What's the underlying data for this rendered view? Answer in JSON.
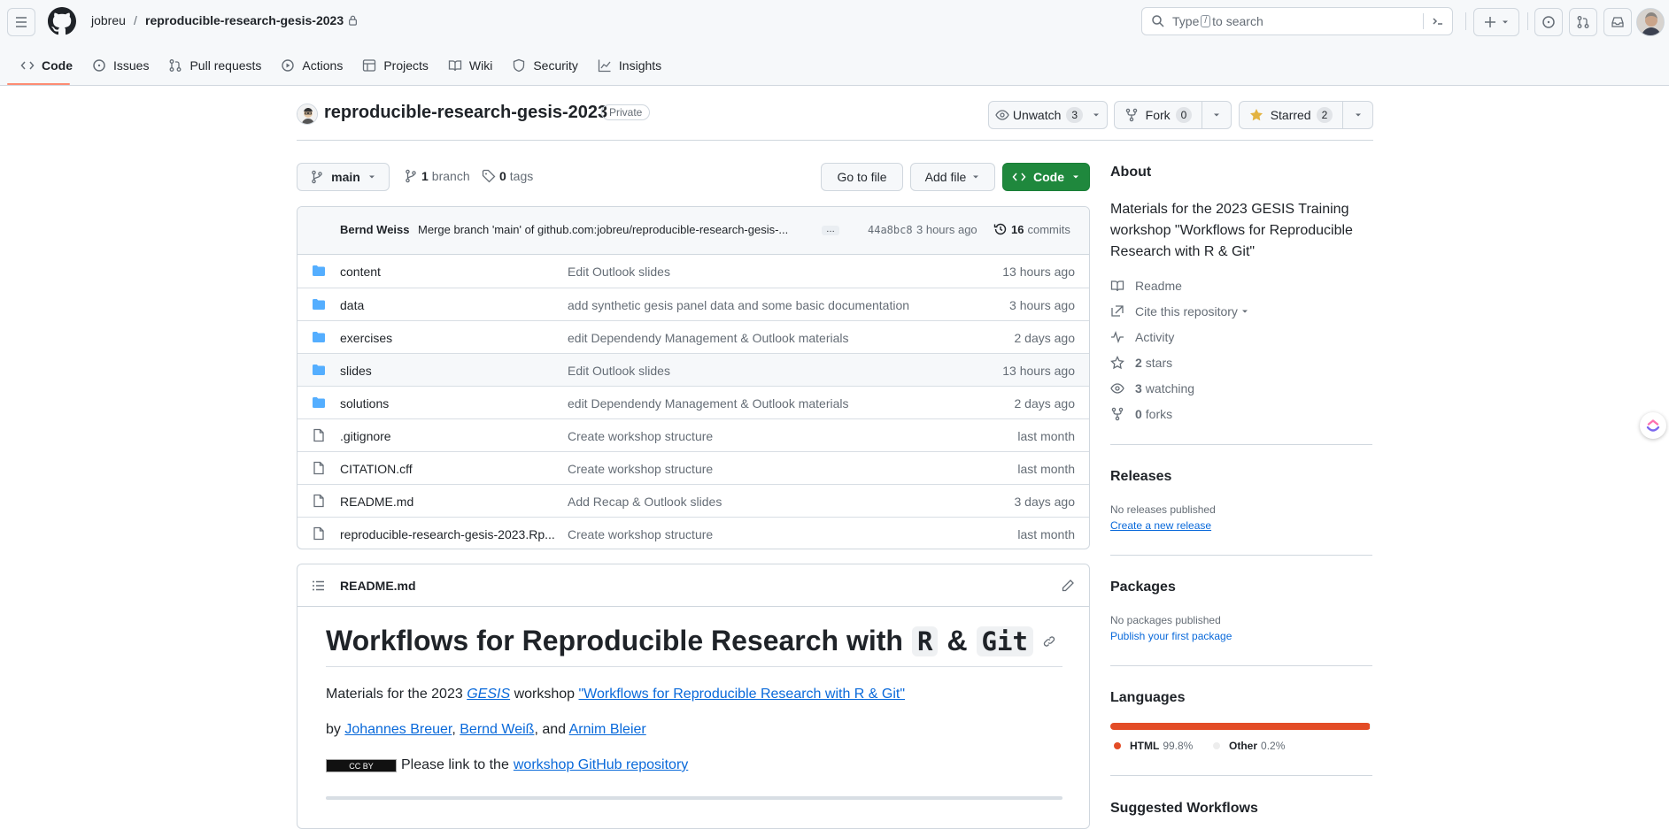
{
  "header": {
    "owner": "jobreu",
    "repo": "reproducible-research-gesis-2023",
    "search_prefix": "Type",
    "search_key": "/",
    "search_suffix": "to search"
  },
  "nav": {
    "tabs": [
      {
        "label": "Code"
      },
      {
        "label": "Issues"
      },
      {
        "label": "Pull requests"
      },
      {
        "label": "Actions"
      },
      {
        "label": "Projects"
      },
      {
        "label": "Wiki"
      },
      {
        "label": "Security"
      },
      {
        "label": "Insights"
      }
    ]
  },
  "repo": {
    "name": "reproducible-research-gesis-2023",
    "visibility": "Private",
    "unwatch_label": "Unwatch",
    "watch_count": "3",
    "fork_label": "Fork",
    "fork_count": "0",
    "star_label": "Starred",
    "star_count": "2"
  },
  "toolbar": {
    "branch": "main",
    "branch_count": "1",
    "branch_label": "branch",
    "tag_count": "0",
    "tag_label": "tags",
    "goto_file": "Go to file",
    "add_file": "Add file",
    "code": "Code"
  },
  "commit": {
    "author": "Bernd Weiss",
    "message": "Merge branch 'main' of github.com:jobreu/reproducible-research-gesis-...",
    "ellipsis": "…",
    "sha": "44a8bc8",
    "time": "3 hours ago",
    "count": "16",
    "count_label": "commits"
  },
  "files": [
    {
      "name": "content",
      "type": "dir",
      "message": "Edit Outlook slides",
      "time": "13 hours ago"
    },
    {
      "name": "data",
      "type": "dir",
      "message": "add synthetic gesis panel data and some basic documentation",
      "time": "3 hours ago"
    },
    {
      "name": "exercises",
      "type": "dir",
      "message": "edit Dependendy Management & Outlook materials",
      "time": "2 days ago"
    },
    {
      "name": "slides",
      "type": "dir",
      "message": "Edit Outlook slides",
      "time": "13 hours ago"
    },
    {
      "name": "solutions",
      "type": "dir",
      "message": "edit Dependendy Management & Outlook materials",
      "time": "2 days ago"
    },
    {
      "name": ".gitignore",
      "type": "file",
      "message": "Create workshop structure",
      "time": "last month"
    },
    {
      "name": "CITATION.cff",
      "type": "file",
      "message": "Create workshop structure",
      "time": "last month"
    },
    {
      "name": "README.md",
      "type": "file",
      "message": "Add Recap & Outlook slides",
      "time": "3 days ago"
    },
    {
      "name": "reproducible-research-gesis-2023.Rp...",
      "type": "file",
      "message": "Create workshop structure",
      "time": "last month"
    }
  ],
  "readme": {
    "filename": "README.md",
    "title_prefix": "Workflows for Reproducible Research with",
    "title_code1": "R",
    "title_amp": "&",
    "title_code2": "Git",
    "p1_pre": "Materials for the 2023",
    "p1_gesis": "GESIS",
    "p1_mid": "workshop",
    "p1_link": "\"Workflows for Reproducible Research with R & Git\"",
    "p2_pre": "by",
    "author1": "Johannes Breuer",
    "comma": ",",
    "author2": "Bernd Weiß",
    "and": ", and",
    "author3": "Arnim Bleier",
    "license_badge": "CC BY",
    "p3_pre": "Please link to the",
    "p3_link": "workshop GitHub repository"
  },
  "about": {
    "heading": "About",
    "description": "Materials for the 2023 GESIS Training workshop \"Workflows for Reproducible Research with R & Git\"",
    "readme": "Readme",
    "cite": "Cite this repository",
    "activity": "Activity",
    "stars_count": "2",
    "stars_label": "stars",
    "watching_count": "3",
    "watching_label": "watching",
    "forks_count": "0",
    "forks_label": "forks"
  },
  "releases": {
    "heading": "Releases",
    "none": "No releases published",
    "create": "Create a new release"
  },
  "packages": {
    "heading": "Packages",
    "none": "No packages published",
    "publish": "Publish your first package"
  },
  "languages": {
    "heading": "Languages",
    "items": [
      {
        "name": "HTML",
        "percent": "99.8%",
        "fraction": 0.998,
        "color": "#e34c26"
      },
      {
        "name": "Other",
        "percent": "0.2%",
        "fraction": 0.002,
        "color": "#ededed"
      }
    ]
  },
  "suggested": {
    "heading": "Suggested Workflows"
  }
}
